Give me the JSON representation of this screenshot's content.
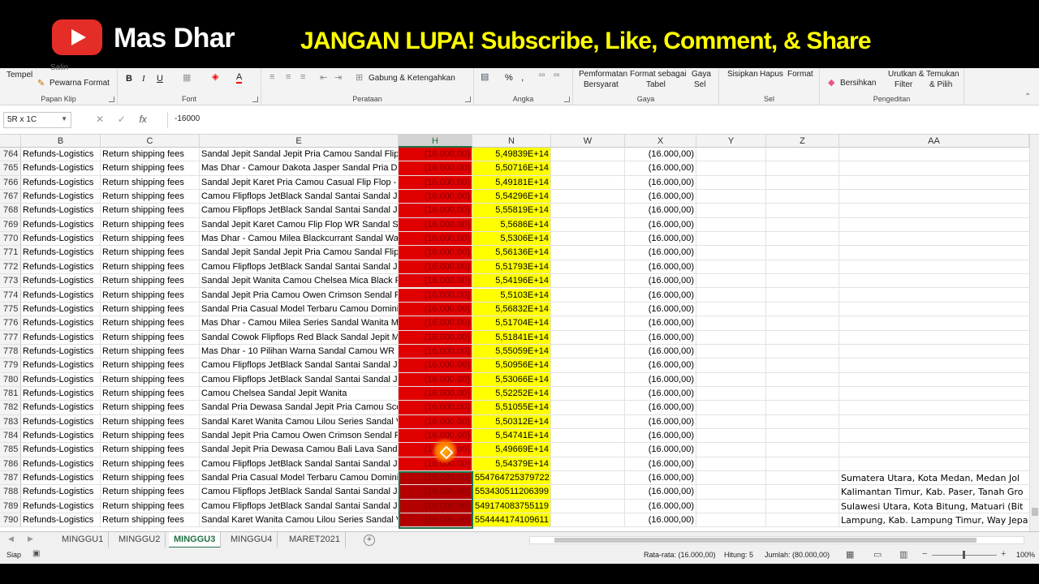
{
  "banner": {
    "channel_name": "Mas Dhar",
    "call_to_action": "JANGAN LUPA! Subscribe, Like, Comment, & Share",
    "icon": "youtube-play-icon"
  },
  "ribbon": {
    "clipboard": {
      "paste_label": "Tempel",
      "cut_label": "Salin",
      "format_painter_label": "Pewarna Format",
      "group_label": "Papan Klip"
    },
    "font": {
      "bold": "B",
      "italic": "I",
      "underline": "U",
      "font_color": "A",
      "group_label": "Font"
    },
    "alignment": {
      "merge_label": "Gabung & Ketengahkan",
      "group_label": "Perataan"
    },
    "number": {
      "percent": "%",
      "comma": ",",
      "group_label": "Angka"
    },
    "styles": {
      "conditional_label_1": "Pemformatan",
      "conditional_label_2": "Bersyarat",
      "format_table_label_1": "Format sebagai",
      "format_table_label_2": "Tabel",
      "cell_styles_label_1": "Gaya",
      "cell_styles_label_2": "Sel",
      "group_label": "Gaya"
    },
    "cells": {
      "insert_label": "Sisipkan",
      "delete_label": "Hapus",
      "format_label": "Format",
      "group_label": "Sel"
    },
    "editing": {
      "clear_label": "Bersihkan",
      "sort_label_1": "Urutkan &",
      "sort_label_2": "Filter",
      "find_label_1": "Temukan",
      "find_label_2": "& Pilih",
      "group_label": "Pengeditan"
    }
  },
  "formula_bar": {
    "name_box": "5R x 1C",
    "fx": "fx",
    "formula": "-16000"
  },
  "columns": [
    "B",
    "C",
    "E",
    "H",
    "N",
    "W",
    "X",
    "Y",
    "Z",
    "AA"
  ],
  "rows": [
    {
      "num": "764",
      "b": "Refunds-Logistics",
      "c": "Return shipping fees",
      "e": "Sandal Jepit Sandal Jepit Pria Camou Sandal Flip",
      "h": "(16.000,00)",
      "n": "5,49839E+14",
      "x": "(16.000,00)",
      "aa": ""
    },
    {
      "num": "765",
      "b": "Refunds-Logistics",
      "c": "Return shipping fees",
      "e": "Mas Dhar - Camour Dakota Jasper Sandal Pria D",
      "h": "(16.000,00)",
      "n": "5,50716E+14",
      "x": "(16.000,00)",
      "aa": ""
    },
    {
      "num": "766",
      "b": "Refunds-Logistics",
      "c": "Return shipping fees",
      "e": "Sandal Jepit Karet Pria Camou Casual Flip Flop -",
      "h": "(16.000,00)",
      "n": "5,49181E+14",
      "x": "(16.000,00)",
      "aa": ""
    },
    {
      "num": "767",
      "b": "Refunds-Logistics",
      "c": "Return shipping fees",
      "e": "Camou Flipflops JetBlack Sandal Santai Sandal Je",
      "h": "(16.000,00)",
      "n": "5,54296E+14",
      "x": "(16.000,00)",
      "aa": ""
    },
    {
      "num": "768",
      "b": "Refunds-Logistics",
      "c": "Return shipping fees",
      "e": "Camou Flipflops JetBlack Sandal Santai Sandal Je",
      "h": "(16.000,00)",
      "n": "5,55819E+14",
      "x": "(16.000,00)",
      "aa": ""
    },
    {
      "num": "769",
      "b": "Refunds-Logistics",
      "c": "Return shipping fees",
      "e": "Sandal Jepit Karet Camou Flip Flop WR Sandal Se",
      "h": "(16.000,00)",
      "n": "5,5686E+14",
      "x": "(16.000,00)",
      "aa": ""
    },
    {
      "num": "770",
      "b": "Refunds-Logistics",
      "c": "Return shipping fees",
      "e": "Mas Dhar - Camou Milea Blackcurrant Sandal Wa",
      "h": "(16.000,00)",
      "n": "5,5306E+14",
      "x": "(16.000,00)",
      "aa": ""
    },
    {
      "num": "771",
      "b": "Refunds-Logistics",
      "c": "Return shipping fees",
      "e": "Sandal Jepit Sandal Jepit Pria Camou Sandal Flip",
      "h": "(16.000,00)",
      "n": "5,56136E+14",
      "x": "(16.000,00)",
      "aa": ""
    },
    {
      "num": "772",
      "b": "Refunds-Logistics",
      "c": "Return shipping fees",
      "e": "Camou Flipflops JetBlack Sandal Santai Sandal Je",
      "h": "(16.000,00)",
      "n": "5,51793E+14",
      "x": "(16.000,00)",
      "aa": ""
    },
    {
      "num": "773",
      "b": "Refunds-Logistics",
      "c": "Return shipping fees",
      "e": "Sandal Jepit Wanita Camou Chelsea Mica Black F",
      "h": "(16.000,00)",
      "n": "5,54196E+14",
      "x": "(16.000,00)",
      "aa": ""
    },
    {
      "num": "774",
      "b": "Refunds-Logistics",
      "c": "Return shipping fees",
      "e": "Sandal Jepit Pria Camou Owen Crimson Sendal F",
      "h": "(16.000,00)",
      "n": "5,5103E+14",
      "x": "(16.000,00)",
      "aa": ""
    },
    {
      "num": "775",
      "b": "Refunds-Logistics",
      "c": "Return shipping fees",
      "e": "Sandal Pria Casual Model Terbaru Camou Domini",
      "h": "(16.000,00)",
      "n": "5,56832E+14",
      "x": "(16.000,00)",
      "aa": ""
    },
    {
      "num": "776",
      "b": "Refunds-Logistics",
      "c": "Return shipping fees",
      "e": "Mas Dhar - Camou Milea Series Sandal Wanita M",
      "h": "(16.000,00)",
      "n": "5,51704E+14",
      "x": "(16.000,00)",
      "aa": ""
    },
    {
      "num": "777",
      "b": "Refunds-Logistics",
      "c": "Return shipping fees",
      "e": "Sandal Cowok Flipflops Red Black Sandal Jepit M",
      "h": "(16.000,00)",
      "n": "5,51841E+14",
      "x": "(16.000,00)",
      "aa": ""
    },
    {
      "num": "778",
      "b": "Refunds-Logistics",
      "c": "Return shipping fees",
      "e": "Mas Dhar - 10 Pilihan Warna Sandal Camou WR",
      "h": "(16.000,00)",
      "n": "5,55059E+14",
      "x": "(16.000,00)",
      "aa": ""
    },
    {
      "num": "779",
      "b": "Refunds-Logistics",
      "c": "Return shipping fees",
      "e": "Camou Flipflops JetBlack Sandal Santai Sandal Je",
      "h": "(16.000,00)",
      "n": "5,50956E+14",
      "x": "(16.000,00)",
      "aa": ""
    },
    {
      "num": "780",
      "b": "Refunds-Logistics",
      "c": "Return shipping fees",
      "e": "Camou Flipflops JetBlack Sandal Santai Sandal Je",
      "h": "(16.000,00)",
      "n": "5,53066E+14",
      "x": "(16.000,00)",
      "aa": ""
    },
    {
      "num": "781",
      "b": "Refunds-Logistics",
      "c": "Return shipping fees",
      "e": "Camou Chelsea Sandal Jepit Wanita",
      "h": "(16.000,00)",
      "n": "5,52252E+14",
      "x": "(16.000,00)",
      "aa": ""
    },
    {
      "num": "782",
      "b": "Refunds-Logistics",
      "c": "Return shipping fees",
      "e": "Sandal Pria Dewasa Sandal Jepit Pria Camou Sco",
      "h": "(16.000,00)",
      "n": "5,51055E+14",
      "x": "(16.000,00)",
      "aa": ""
    },
    {
      "num": "783",
      "b": "Refunds-Logistics",
      "c": "Return shipping fees",
      "e": "Sandal Karet Wanita Camou Lilou Series Sandal V",
      "h": "(16.000,00)",
      "n": "5,50312E+14",
      "x": "(16.000,00)",
      "aa": ""
    },
    {
      "num": "784",
      "b": "Refunds-Logistics",
      "c": "Return shipping fees",
      "e": "Sandal Jepit Pria Camou Owen Crimson Sendal F",
      "h": "(16.000,00)",
      "n": "5,54741E+14",
      "x": "(16.000,00)",
      "aa": ""
    },
    {
      "num": "785",
      "b": "Refunds-Logistics",
      "c": "Return shipping fees",
      "e": "Sandal Jepit Pria Dewasa Camou Bali Lava Sanda",
      "h": "(16.000,00)",
      "n": "5,49669E+14",
      "x": "(16.000,00)",
      "aa": ""
    },
    {
      "num": "786",
      "b": "Refunds-Logistics",
      "c": "Return shipping fees",
      "e": "Camou Flipflops JetBlack Sandal Santai Sandal Je",
      "h": "(16.000,00)",
      "n": "5,54379E+14",
      "x": "(16.000,00)",
      "aa": ""
    },
    {
      "num": "787",
      "b": "Refunds-Logistics",
      "c": "Return shipping fees",
      "e": "Sandal Pria Casual Model Terbaru Camou Domini",
      "h": "(16.000,00)",
      "n": "554764725379722",
      "x": "(16.000,00)",
      "aa": "Sumatera Utara, Kota Medan, Medan Jol"
    },
    {
      "num": "788",
      "b": "Refunds-Logistics",
      "c": "Return shipping fees",
      "e": "Camou Flipflops JetBlack Sandal Santai Sandal Je",
      "h": "(16.000,00)",
      "n": "553430511206399",
      "x": "(16.000,00)",
      "aa": "Kalimantan Timur, Kab. Paser, Tanah Gro"
    },
    {
      "num": "789",
      "b": "Refunds-Logistics",
      "c": "Return shipping fees",
      "e": "Camou Flipflops JetBlack Sandal Santai Sandal Je",
      "h": "(16.000,00)",
      "n": "549174083755119",
      "x": "(16.000,00)",
      "aa": "Sulawesi Utara, Kota Bitung, Matuari (Bit"
    },
    {
      "num": "790",
      "b": "Refunds-Logistics",
      "c": "Return shipping fees",
      "e": "Sandal Karet Wanita Camou Lilou Series Sandal V",
      "h": "(16.000,00)",
      "n": "554444174109611",
      "x": "(16.000,00)",
      "aa": "Lampung, Kab. Lampung Timur, Way Jepa"
    }
  ],
  "sheet_tabs": [
    "MINGGU1",
    "MINGGU2",
    "MINGGU3",
    "MINGGU4",
    "MARET2021"
  ],
  "active_tab": "MINGGU3",
  "status_bar": {
    "mode": "Siap",
    "average": "Rata-rata: (16.000,00)",
    "count": "Hitung: 5",
    "sum": "Jumlah: (80.000,00)",
    "zoom": "100%"
  },
  "colors": {
    "highlight_red": "#e00000",
    "highlight_yellow": "#ffff00",
    "excel_green": "#217346"
  }
}
